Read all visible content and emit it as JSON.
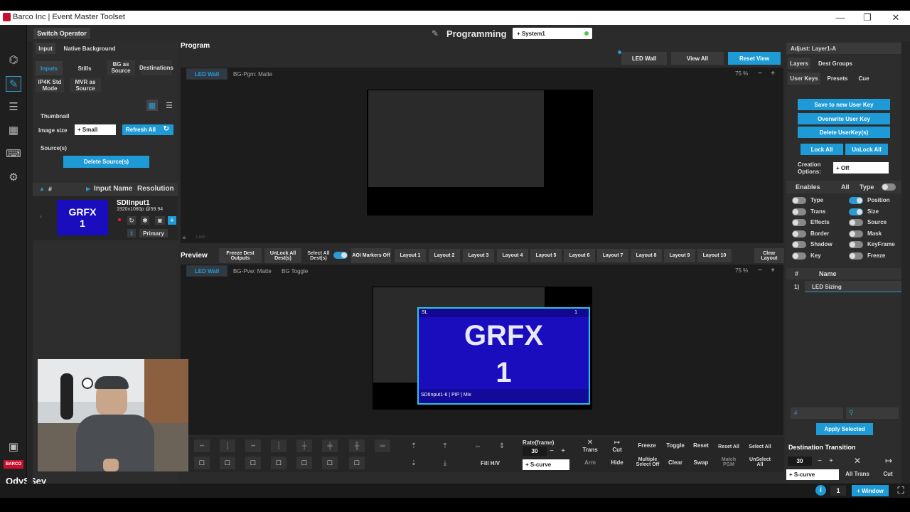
{
  "window": {
    "title": "Barco Inc | Event Master Toolset",
    "minimize": "—",
    "maximize": "❐",
    "close": "✕"
  },
  "header": {
    "switch_operator": "Switch Operator",
    "mode": "Programming",
    "system": "+ System1"
  },
  "left_panel": {
    "top_tabs": [
      "Input",
      "Native Background"
    ],
    "sub_tabs": [
      "Inputs",
      "Stills",
      "BG as Source",
      "Destinations"
    ],
    "sub_tabs2": [
      "IP4K Std Mode",
      "MVR as Source"
    ],
    "thumbnail_label": "Thumbnail",
    "image_size_label": "Image size",
    "image_size_value": "+ Small",
    "refresh_all": "Refresh All",
    "sources_label": "Source(s)",
    "delete_sources": "Delete Source(s)",
    "table_headers": [
      "#",
      "Input Name",
      "Resolution"
    ],
    "input": {
      "thumb_line1": "GRFX",
      "thumb_line2": "1",
      "name": "SDIInput1",
      "resolution": "1920x1080p @59.94",
      "primary": "Primary"
    }
  },
  "program": {
    "label": "Program",
    "buttons": [
      "LED Wall",
      "View All",
      "Reset View"
    ],
    "dest_tab": "LED Wall",
    "bg_label": "BG-Pgm: Matte",
    "zoom": "75 %",
    "live": "LIVE"
  },
  "preview": {
    "label": "Preview",
    "buttons": [
      "Freeze Dest Outputs",
      "UnLock All Dest(s)",
      "Select All Dest(s)",
      "AOI Markers Off",
      "Layout 1",
      "Layout 2",
      "Layout 3",
      "Layout 4",
      "Layout 5",
      "Layout 6",
      "Layout 7",
      "Layout 8",
      "Layout 9",
      "Layout 10",
      "Clear Layout"
    ],
    "dest_tab": "LED Wall",
    "bg_label": "BG-Pvw: Matte",
    "bg_toggle": "BG Toggle",
    "zoom": "75 %",
    "layer": {
      "tag_left": "SL",
      "tag_right": "1",
      "line1": "GRFX",
      "line2": "1",
      "caption": "SDIInput1-6 | PIP | Mix"
    }
  },
  "bottom_toolbar": {
    "fill_hv": "Fill H/V",
    "rate_label": "Rate(frame)",
    "rate_value": "30",
    "curve": "+ S-curve",
    "buttons_top": [
      "Trans",
      "Cut",
      "Freeze",
      "Toggle",
      "Reset",
      "Reset All",
      "Select All"
    ],
    "buttons_bottom": [
      "Arm",
      "Hide",
      "Multiple Select Off",
      "Clear",
      "Swap",
      "Match PGM",
      "UnSelect All"
    ]
  },
  "right_panel": {
    "adjust_label": "Adjust: Layer1-A",
    "tabs": [
      "Layers",
      "Dest Groups"
    ],
    "sub_tabs": [
      "User Keys",
      "Presets",
      "Cue"
    ],
    "buttons": [
      "Save to new User Key",
      "Overwrite User Key",
      "Delete UserKey(s)"
    ],
    "lock_all": "Lock All",
    "unlock_all": "UnLock All",
    "creation_options_label": "Creation Options:",
    "creation_options_value": "+ Off",
    "enables_label": "Enables",
    "all_label": "All",
    "type_label": "Type",
    "enables": [
      {
        "label": "Type",
        "on": false
      },
      {
        "label": "Position",
        "on": true
      },
      {
        "label": "Trans",
        "on": false
      },
      {
        "label": "Size",
        "on": true
      },
      {
        "label": "Effects",
        "on": false
      },
      {
        "label": "Source",
        "on": false
      },
      {
        "label": "Border",
        "on": false
      },
      {
        "label": "Mask",
        "on": false
      },
      {
        "label": "Shadow",
        "on": false
      },
      {
        "label": "KeyFrame",
        "on": false
      },
      {
        "label": "Key",
        "on": false
      },
      {
        "label": "Freeze",
        "on": false
      }
    ],
    "list_headers": [
      "#",
      "Name"
    ],
    "list_item_index": "1)",
    "list_item_name": "LED Sizing",
    "search_placeholder": "#",
    "apply_selected": "Apply Selected",
    "dest_transition_label": "Destination Transition",
    "dest_rate": "30",
    "dest_curve": "+ S-curve",
    "all_trans": "All Trans",
    "cut": "Cut"
  },
  "statusbar": {
    "info": "i",
    "count": "1",
    "window": "+ Window"
  },
  "colors": {
    "accent": "#1e9bd7",
    "brand": "#c8102e",
    "layer_fill": "#1a0dbd"
  }
}
